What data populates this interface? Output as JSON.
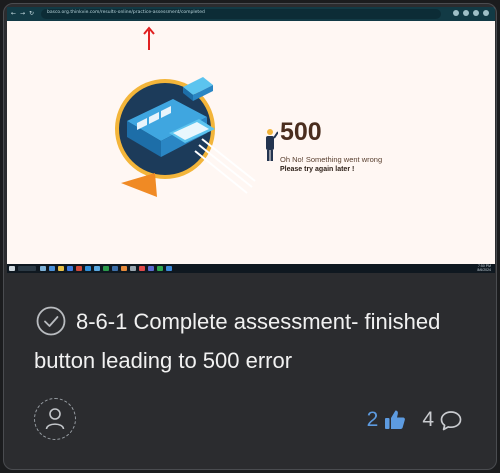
{
  "screenshot": {
    "browser": {
      "url": "basco.org.thinkvie.com/results-online/practice-assessment/completed"
    },
    "error": {
      "code": "500",
      "message": "Oh No! Something went wrong",
      "retry": "Please try again later !"
    },
    "taskbar": {
      "time": "7:50 PM",
      "date": "8/6/2024"
    }
  },
  "post": {
    "title": "8-6-1 Complete assessment- finished button leading to 500 error",
    "likes": "2",
    "comments": "4"
  },
  "colors": {
    "card_bg": "#2b2c2f",
    "accent_blue": "#5d9be0",
    "error_brown": "#4a2d1e",
    "illustration_navy": "#1f4a6e",
    "illustration_orange": "#f08a24"
  }
}
